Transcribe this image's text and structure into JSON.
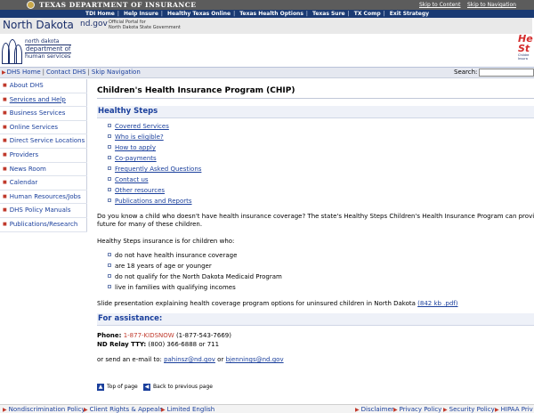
{
  "tdi_band": {
    "title": "Texas Department of Insurance",
    "skip_content": "Skip to Content",
    "skip_navigation": "Skip to Navigation"
  },
  "tdi_links": [
    "TDI Home",
    "Help Insure",
    "Healthy Texas Online",
    "Texas Health Options",
    "Texas Sure",
    "TX Comp",
    "Exit Strategy"
  ],
  "header": {
    "state_name": "North Dakota",
    "portal_url": "nd.gov",
    "portal_tagline_1": "Official Portal for",
    "portal_tagline_2": "North Dakota State Government",
    "dhs_logo_line1": "north dakota",
    "dhs_logo_line2": "department of",
    "dhs_logo_line3": "human services",
    "hs_logo_1": "He",
    "hs_logo_2": "St",
    "hs_logo_3": "Childre\nInsura"
  },
  "navbar": {
    "links": [
      "DHS Home",
      "Contact DHS",
      "Skip Navigation"
    ],
    "search_label": "Search:",
    "search_value": ""
  },
  "leftnav": [
    {
      "label": "About DHS",
      "active": false
    },
    {
      "label": "Services and Help",
      "active": true
    },
    {
      "label": "Business Services",
      "active": false
    },
    {
      "label": "Online Services",
      "active": false
    },
    {
      "label": "Direct Service Locations",
      "active": false
    },
    {
      "label": "Providers",
      "active": false
    },
    {
      "label": "News Room",
      "active": false
    },
    {
      "label": "Calendar",
      "active": false
    },
    {
      "label": "Human Resources/Jobs",
      "active": false
    },
    {
      "label": "DHS Policy Manuals",
      "active": false
    },
    {
      "label": "Publications/Research",
      "active": false
    }
  ],
  "main": {
    "page_title": "Children's Health Insurance Program (CHIP)",
    "section_head": "Healthy Steps",
    "toc": [
      "Covered Services",
      "Who is eligible?",
      "How to apply",
      "Co-payments",
      "Frequently Asked Questions",
      "Contact us",
      "Other resources",
      "Publications and Reports"
    ],
    "intro_line1": "Do you know a child who doesn't have health insurance coverage? The state's Healthy Steps Children's Health Insurance Program can provide a h",
    "intro_line2": "future for many of these children.",
    "criteria_intro": "Healthy Steps insurance is for children who:",
    "criteria": [
      "do not have health insurance coverage",
      "are 18 years of age or younger",
      "do not qualify for the North Dakota Medicaid Program",
      "live in families with qualifying incomes"
    ],
    "slide_text": "Slide presentation explaining health coverage program options for uninsured children in North Dakota",
    "slide_link": "(842 kb .pdf)",
    "assist_head": "For assistance:",
    "phone_label": "Phone:",
    "phone_red": "1-877-KIDSNOW",
    "phone_rest": "(1-877-543-7669)",
    "relay_label": "ND Relay TTY:",
    "relay_rest": "(800) 366-6888 or 711",
    "email_text": "or send an e-mail to:",
    "email_1": "pahinsz@nd.gov",
    "email_or": "or",
    "email_2": "bjennings@nd.gov",
    "top_of_page": "Top of page",
    "back_prev": "Back to previous page"
  },
  "footer": {
    "left": [
      "Nondiscrimination Policy",
      "Client Rights & Appeals",
      "Limited English"
    ],
    "right": [
      "Disclaimer",
      "Privacy Policy",
      "Security Policy",
      "HIPAA Priv"
    ]
  },
  "colors": {
    "link": "#1a3f9c",
    "accent_red": "#c0392b",
    "tdi_band": "#5c5c5c",
    "tdi_links": "#1a3a73"
  }
}
